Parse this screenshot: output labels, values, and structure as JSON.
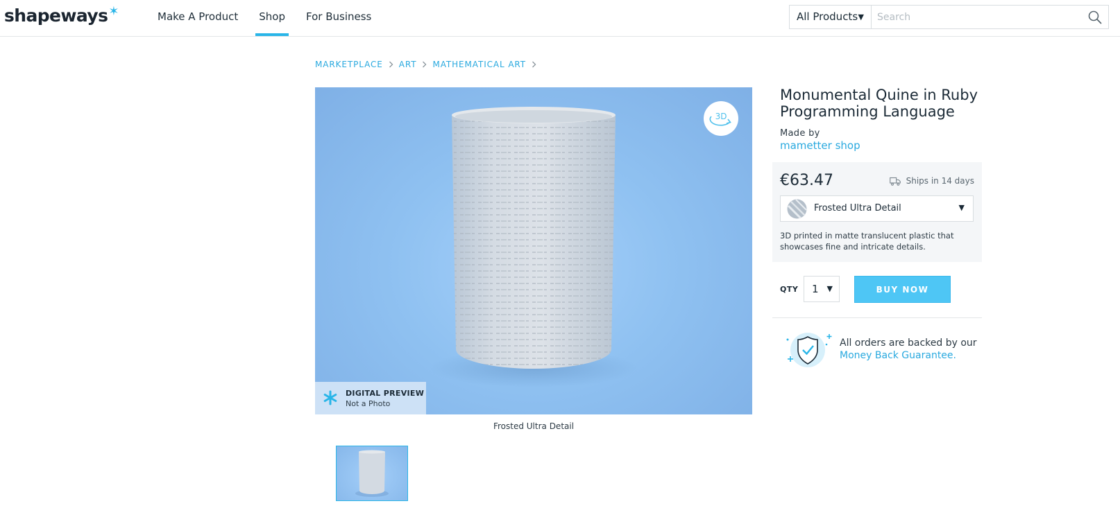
{
  "header": {
    "logo_text": "shapeways",
    "logo_star": "✶",
    "nav": [
      {
        "label": "Make A Product"
      },
      {
        "label": "Shop"
      },
      {
        "label": "For Business"
      }
    ],
    "category_select": "All Products",
    "search_placeholder": "Search"
  },
  "breadcrumb": [
    "MARKETPLACE",
    "ART",
    "MATHEMATICAL ART"
  ],
  "preview": {
    "badge_title": "DIGITAL PREVIEW",
    "badge_subtitle": "Not a Photo",
    "button_3d": "3D",
    "caption": "Frosted Ultra Detail"
  },
  "product": {
    "title": "Monumental Quine in Ruby Programming Language",
    "made_by_label": "Made by",
    "shop_name": "mametter shop",
    "price": "€63.47",
    "ships": "Ships in 14 days",
    "material": "Frosted Ultra Detail",
    "material_description": "3D printed in matte translucent plastic that showcases fine and intricate details.",
    "qty_label": "QTY",
    "qty_value": "1",
    "buy_label": "BUY NOW",
    "guarantee_text": "All orders are backed by our",
    "guarantee_link": "Money Back Guarantee."
  },
  "colors": {
    "accent": "#29b5e8",
    "link": "#29a9df",
    "buy_button": "#4ec6f5",
    "preview_bg": "#8fc1f1"
  },
  "icons": [
    "star-icon",
    "chevron-down-icon",
    "search-icon",
    "chevron-right-icon",
    "rotate-3d-icon",
    "truck-icon",
    "material-swatch",
    "shield-check-icon"
  ]
}
